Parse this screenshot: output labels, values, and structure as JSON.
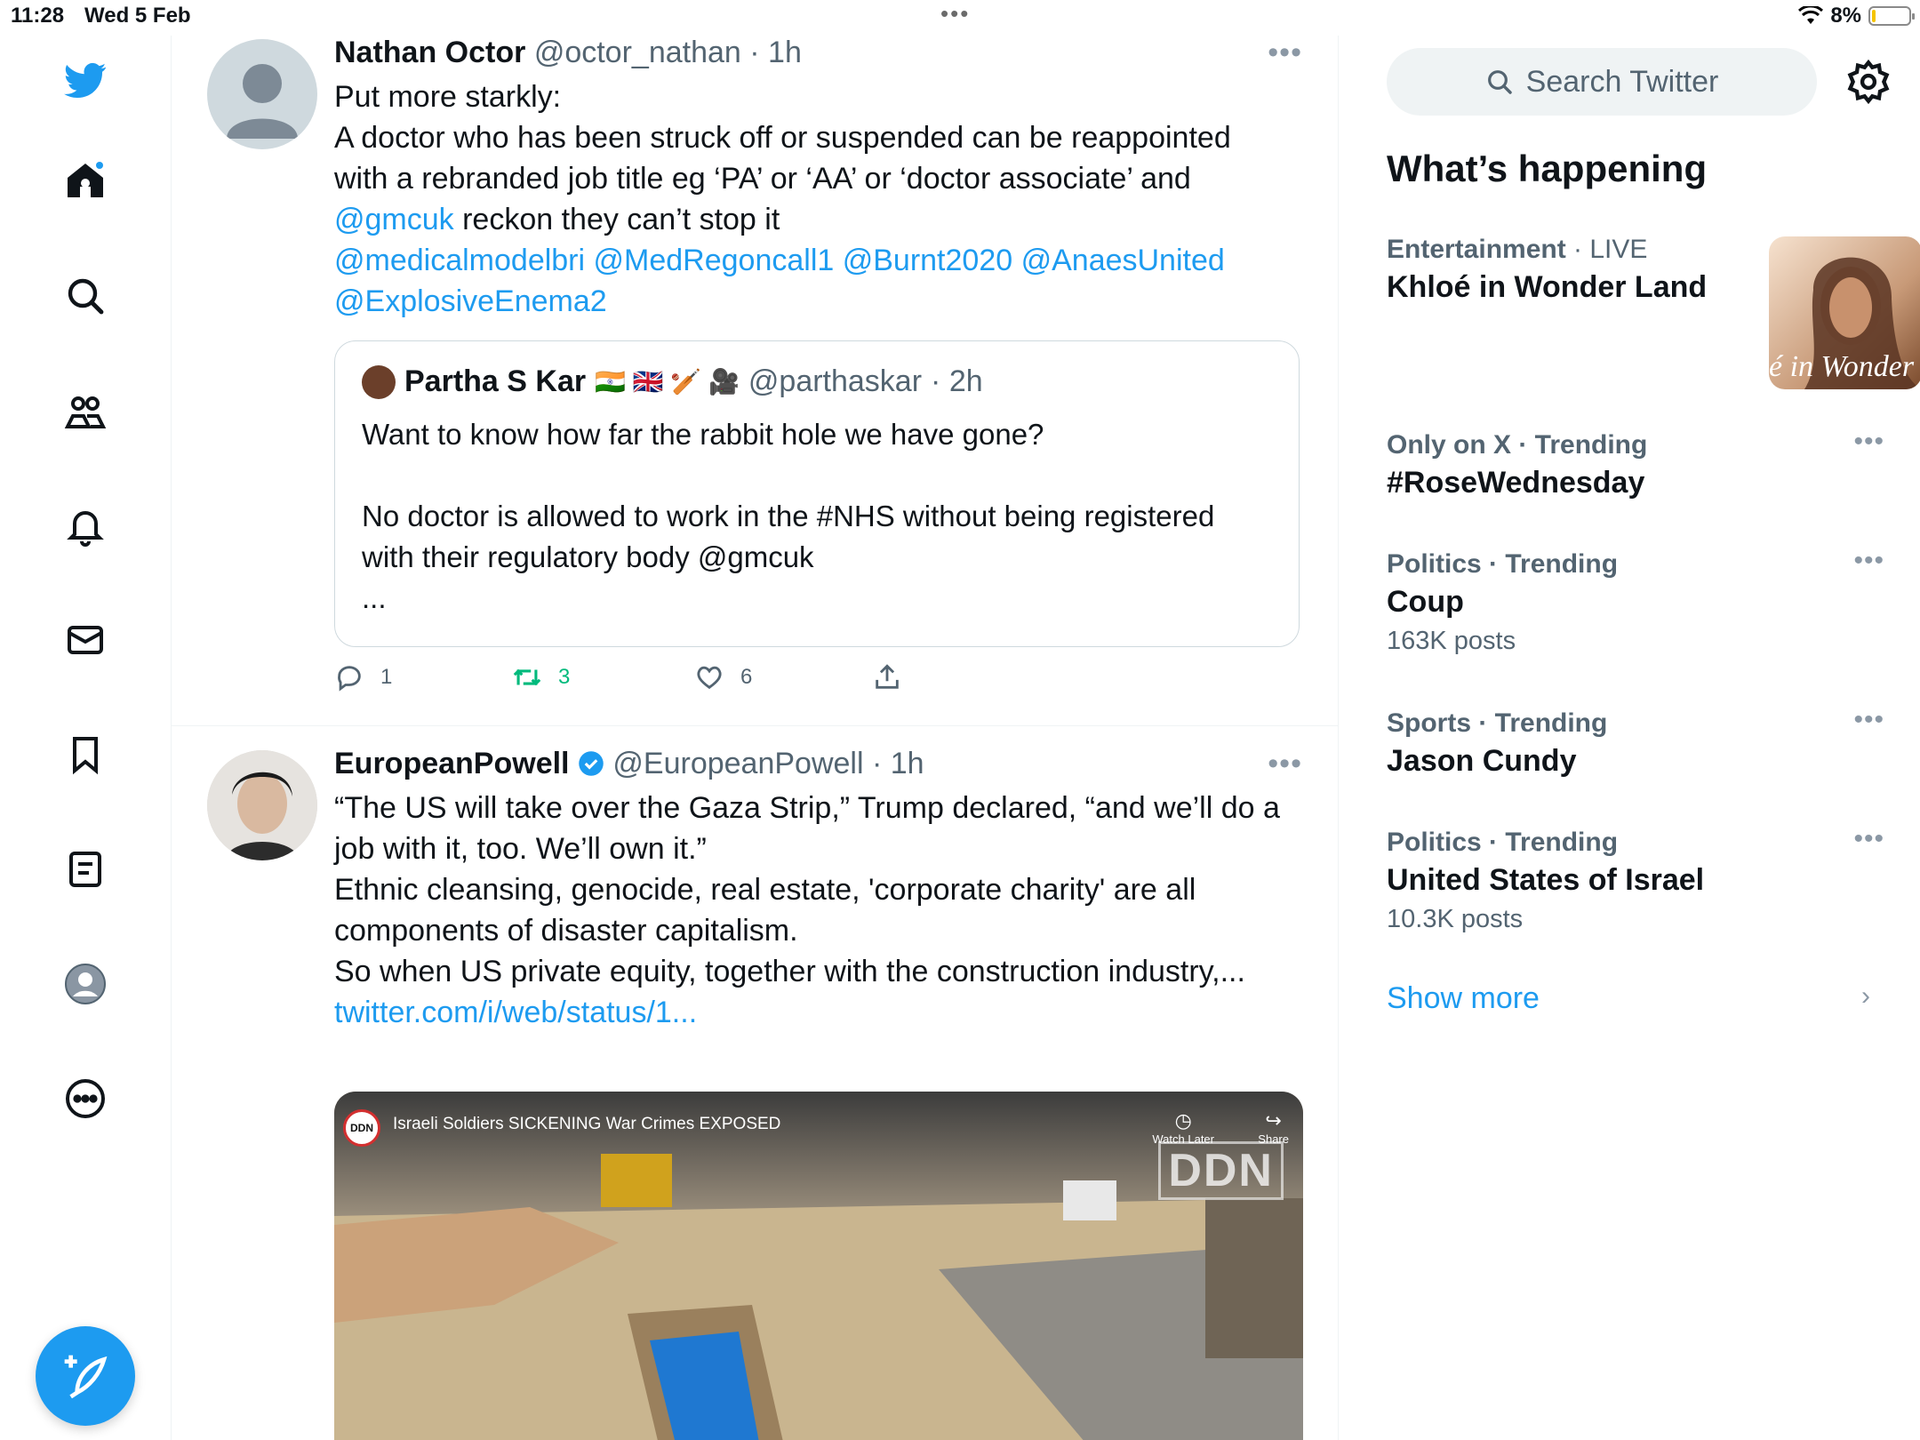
{
  "status_bar": {
    "time": "11:28",
    "date": "Wed 5 Feb",
    "battery": "8%",
    "battery_level": 0.08
  },
  "nav": {
    "items": [
      {
        "icon": "twitter-bird-icon"
      },
      {
        "icon": "home-icon"
      },
      {
        "icon": "search-icon"
      },
      {
        "icon": "communities-icon"
      },
      {
        "icon": "bell-icon"
      },
      {
        "icon": "mail-icon"
      },
      {
        "icon": "bookmark-icon"
      },
      {
        "icon": "lists-icon"
      },
      {
        "icon": "profile-icon"
      },
      {
        "icon": "more-icon"
      }
    ],
    "compose_icon": "compose-icon"
  },
  "tweets": [
    {
      "name": "Nathan Octor",
      "handle": "@octor_nathan",
      "time": "· 1h",
      "text_lines": [
        "Put more starkly:",
        "A doctor who has been struck off or suspended can be reappointed",
        "with a rebranded job title eg ‘PA’ or ‘AA’ or ‘doctor associate’ and"
      ],
      "mention_gmc": "@gmcuk",
      "line4_rest": " reckon they can’t stop it",
      "mentions_line1": "@medicalmodelbri @MedRegoncall1 @Burnt2020 @AnaesUnited",
      "mentions_line2": "@ExplosiveEnema2",
      "quote": {
        "name": "Partha S Kar",
        "emoji": "🇮🇳 🇬🇧 🏏 🎥",
        "handle": "@parthaskar",
        "time": "· 2h",
        "line1": "Want to know how far the rabbit hole we have gone?",
        "line2": "No doctor is allowed to work in the #NHS without being registered",
        "line3": "with their regulatory body @gmcuk",
        "line4": "..."
      },
      "replies": "1",
      "retweets": "3",
      "likes": "6"
    },
    {
      "name": "EuropeanPowell",
      "handle": "@EuropeanPowell",
      "time": "· 1h",
      "text_lines": [
        "“The US will take over the Gaza Strip,” Trump declared, “and we’ll do a",
        "job with it, too. We’ll own it.”",
        "Ethnic cleansing, genocide, real estate, 'corporate charity' are all",
        "components of disaster capitalism.",
        "So when US private equity, together with the construction industry,..."
      ],
      "link": "twitter.com/i/web/status/1...",
      "media": {
        "title": "Israeli Soldiers SICKENING War Crimes EXPOSED",
        "channel_logo": "DDN",
        "watch_later": "Watch Later",
        "share": "Share",
        "watermark": "DDN"
      }
    }
  ],
  "sidebar": {
    "search_placeholder": "Search Twitter",
    "whats_happening": "What’s happening",
    "trends": [
      {
        "category": "Entertainment",
        "status": "· LIVE",
        "name": "Khloé in Wonder Land",
        "image_caption": "é in Wonder L"
      },
      {
        "category": "Only on X · Trending",
        "name": "#RoseWednesday"
      },
      {
        "category": "Politics · Trending",
        "name": "Coup",
        "count": "163K posts"
      },
      {
        "category": "Sports · Trending",
        "name": "Jason Cundy"
      },
      {
        "category": "Politics · Trending",
        "name": "United States of Israel",
        "count": "10.3K posts"
      }
    ],
    "show_more": "Show more"
  },
  "colors": {
    "accent": "#1d9bf0",
    "retweet": "#00ba7c",
    "secondary_text": "#536471"
  }
}
